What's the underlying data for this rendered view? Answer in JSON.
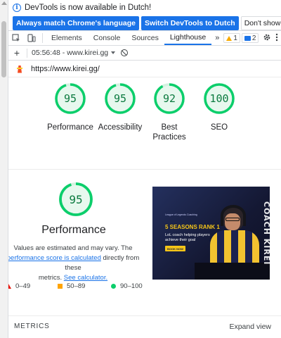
{
  "infobar": {
    "message": "DevTools is now available in Dutch!",
    "buttons": [
      "Always match Chrome's language",
      "Switch DevTools to Dutch",
      "Don't show again"
    ]
  },
  "tabs": {
    "items": [
      "Elements",
      "Console",
      "Sources",
      "Lighthouse"
    ],
    "active": "Lighthouse",
    "more": "»",
    "warnings": "1",
    "messages": "2"
  },
  "lighthouse_toolbar": {
    "report": "05:56:48 - www.kirei.gg"
  },
  "url": "https://www.kirei.gg/",
  "scores": [
    {
      "value": 95,
      "label": "Performance"
    },
    {
      "value": 95,
      "label": "Accessibility"
    },
    {
      "value": 92,
      "label": "Best Practices"
    },
    {
      "value": 100,
      "label": "SEO"
    }
  ],
  "performance": {
    "score": 95,
    "title": "Performance",
    "desc_line1": "Values are estimated and may vary. The",
    "desc_link1": "performance score is calculated",
    "desc_after_link1": "directly from these",
    "desc_line3_prefix": "metrics.",
    "desc_link2": "See calculator."
  },
  "legend": [
    "0–49",
    "50–89",
    "90–100"
  ],
  "thumbnail": {
    "small_text": "League of Legends Coaching",
    "headline": "5 SEASONS RANK 1",
    "sub": "LoL coach helping players achieve their goal",
    "button": "BOOK NOW",
    "vertical": "COACH KIREI"
  },
  "metrics": {
    "label": "METRICS",
    "expand": "Expand view"
  },
  "colors": {
    "pass_green": "#0cce6b",
    "pass_text": "#0b7a3f",
    "link_blue": "#1a73e8",
    "average_orange": "#ffa400",
    "fail_red": "#eb0f00"
  }
}
